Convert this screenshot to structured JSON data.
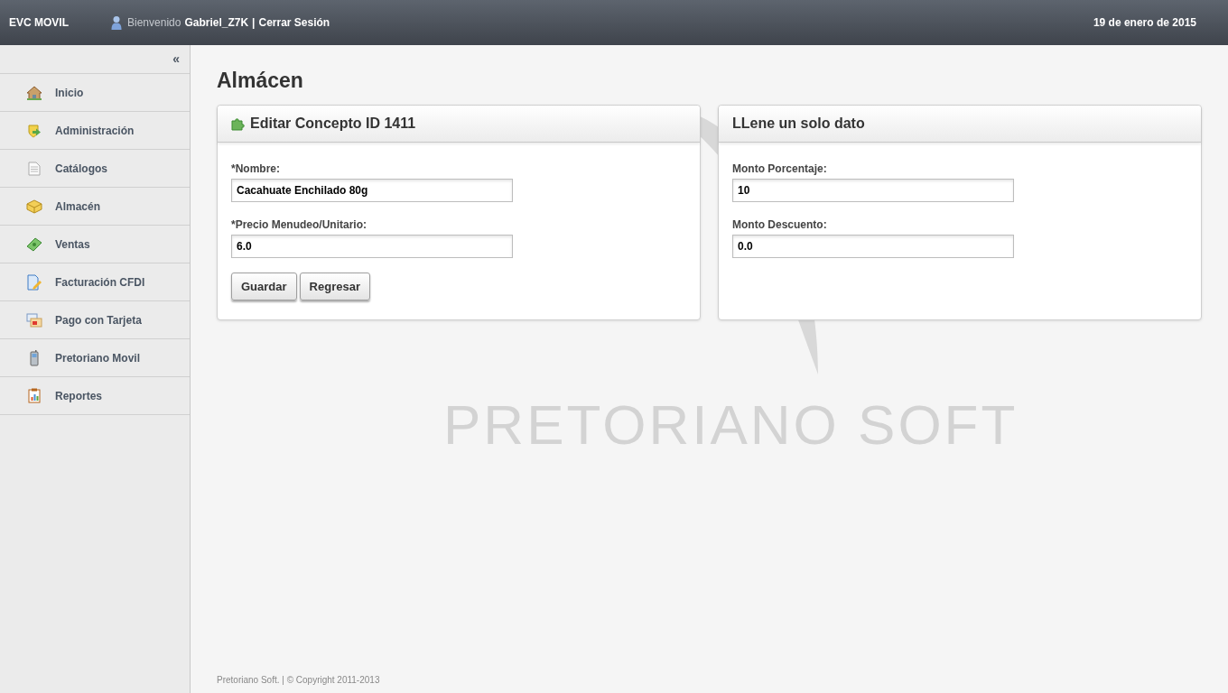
{
  "header": {
    "app_name": "EVC MOVIL",
    "welcome": "Bienvenido",
    "user": "Gabriel_Z7K",
    "separator": "|",
    "logout": "Cerrar Sesión",
    "date": "19 de enero de 2015"
  },
  "sidebar": {
    "collapse": "«",
    "items": [
      {
        "label": "Inicio"
      },
      {
        "label": "Administración"
      },
      {
        "label": "Catálogos"
      },
      {
        "label": "Almacén"
      },
      {
        "label": "Ventas"
      },
      {
        "label": "Facturación CFDI"
      },
      {
        "label": "Pago con Tarjeta"
      },
      {
        "label": "Pretoriano Movil"
      },
      {
        "label": "Reportes"
      }
    ]
  },
  "page_title": "Almácen",
  "background_logo": "PRETORIANO SOFT",
  "panels": [
    {
      "title": "Editar Concepto ID 1411",
      "icon": true,
      "fields": [
        {
          "label": "*Nombre:",
          "value": "Cacahuate Enchilado 80g"
        },
        {
          "label": "*Precio Menudeo/Unitario:",
          "value": "6.0"
        }
      ],
      "buttons": [
        "Guardar",
        "Regresar"
      ]
    },
    {
      "title": "LLene un solo dato",
      "fields": [
        {
          "label": "Monto Porcentaje:",
          "value": "10"
        },
        {
          "label": "Monto Descuento:",
          "value": "0.0"
        }
      ]
    }
  ],
  "footer": "Pretoriano Soft. | © Copyright 2011-2013"
}
